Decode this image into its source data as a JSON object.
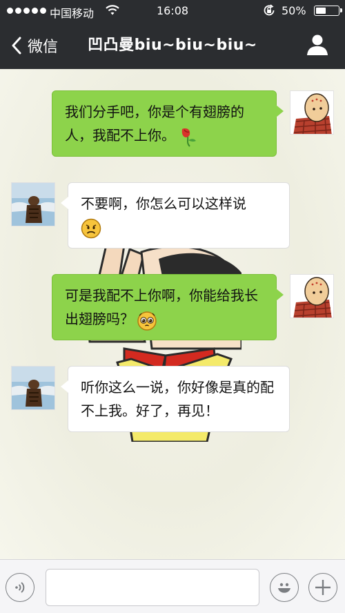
{
  "status_bar": {
    "carrier": "中国移动",
    "time": "16:08",
    "battery_percent": "50%",
    "battery_level": 0.5,
    "icons": [
      "signal-dots-icon",
      "wifi-icon",
      "orientation-lock-icon",
      "battery-icon"
    ]
  },
  "nav": {
    "back_label": "微信",
    "title": "凹凸曼biu~biu~biu~",
    "right_icon": "profile-icon"
  },
  "messages": [
    {
      "side": "out",
      "text": "我们分手吧，你是个有翅膀的人，我配不上你。",
      "emoji": "wilted-rose"
    },
    {
      "side": "in",
      "text": "不要啊，你怎么可以这样说",
      "emoji": "frown-face"
    },
    {
      "side": "out",
      "text": "可是我配不上你啊，你能给我长出翅膀吗？",
      "emoji": "pleading-face"
    },
    {
      "side": "in",
      "text": "听你这么一说，你好像是真的配不上我。好了，再见！",
      "emoji": ""
    }
  ],
  "input_bar": {
    "value": "",
    "icons": [
      "voice-icon",
      "emoji-icon",
      "plus-icon"
    ]
  },
  "colors": {
    "topbar": "#2b2d30",
    "outgoing_bubble": "#8dd34b",
    "incoming_bubble": "#ffffff",
    "chat_background": "#f2f2e6"
  }
}
